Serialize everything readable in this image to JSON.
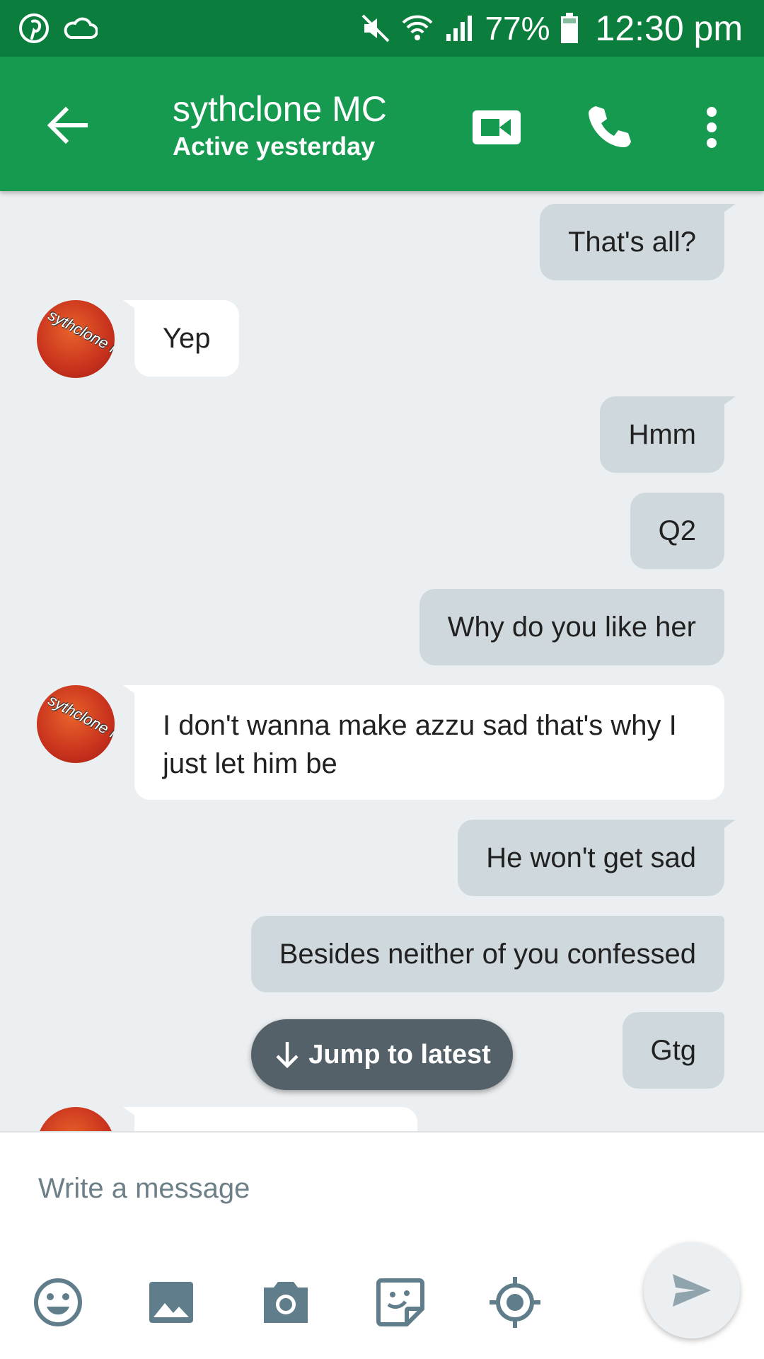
{
  "status_bar": {
    "icons": [
      "pinterest-icon",
      "cloud-icon",
      "mute-icon",
      "wifi-icon",
      "signal-icon",
      "battery-icon"
    ],
    "battery_percent": "77%",
    "time": "12:30 pm"
  },
  "header": {
    "contact_name": "sythclone MC",
    "status": "Active yesterday",
    "actions": [
      "video-call-icon",
      "phone-icon",
      "more-options-icon"
    ],
    "color": "#159a50",
    "status_bar_color": "#0b7e3e"
  },
  "avatar": {
    "text": "sythclone MC"
  },
  "messages": [
    {
      "direction": "out",
      "text": "That's all?"
    },
    {
      "direction": "in",
      "text": "Yep"
    },
    {
      "direction": "out",
      "text": "Hmm"
    },
    {
      "direction": "out",
      "text": "Q2"
    },
    {
      "direction": "out",
      "text": "Why do you like her"
    },
    {
      "direction": "in",
      "text": "I don't wanna make azzu sad that's why I just let him be"
    },
    {
      "direction": "out",
      "text": "He won't get sad"
    },
    {
      "direction": "out",
      "text": "Besides neither of you confessed"
    },
    {
      "direction": "out",
      "text": "Gtg"
    }
  ],
  "jump_button": {
    "label": "Jump to latest"
  },
  "composer": {
    "placeholder": "Write a message",
    "value": "",
    "tools": [
      "emoji-icon",
      "image-icon",
      "camera-icon",
      "sticker-icon",
      "location-icon",
      "send-icon"
    ]
  }
}
